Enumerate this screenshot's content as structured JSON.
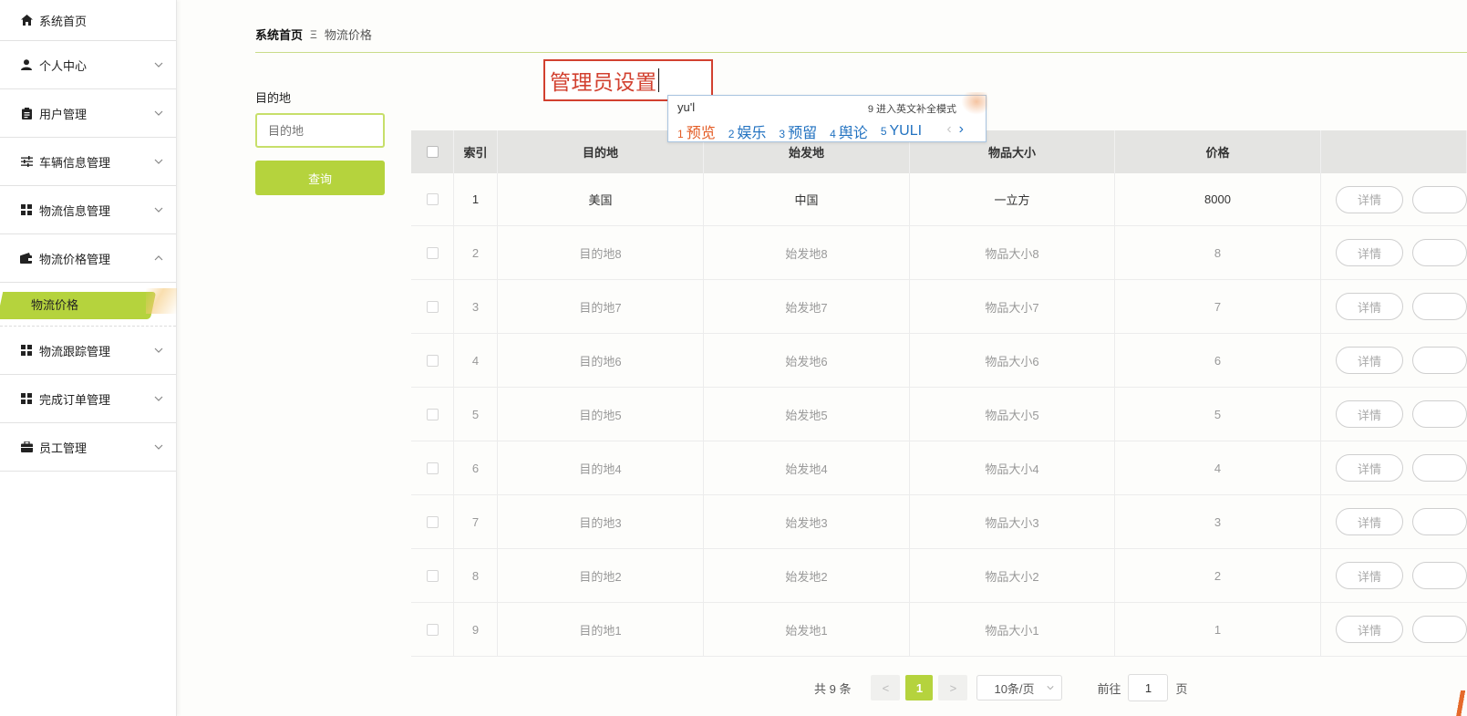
{
  "sidebar": {
    "items": [
      {
        "label": "系统首页",
        "icon": "home-icon"
      },
      {
        "label": "个人中心",
        "icon": "person-icon"
      },
      {
        "label": "用户管理",
        "icon": "clipboard-icon"
      },
      {
        "label": "车辆信息管理",
        "icon": "sliders-icon"
      },
      {
        "label": "物流信息管理",
        "icon": "grid-icon"
      },
      {
        "label": "物流价格管理",
        "icon": "wallet-icon"
      },
      {
        "label": "物流跟踪管理",
        "icon": "grid-icon"
      },
      {
        "label": "完成订单管理",
        "icon": "grid-icon"
      },
      {
        "label": "员工管理",
        "icon": "briefcase-icon"
      }
    ],
    "submenu_active": "物流价格"
  },
  "breadcrumb": {
    "home": "系统首页",
    "separator": "Ξ",
    "current": "物流价格"
  },
  "filter": {
    "label": "目的地",
    "placeholder": "目的地",
    "query_label": "查询"
  },
  "ime": {
    "typed": "管理员设置",
    "pinyin": "yu'l",
    "hint": "9 进入英文补全模式",
    "candidates": [
      {
        "num": "1",
        "text": "预览"
      },
      {
        "num": "2",
        "text": "娱乐"
      },
      {
        "num": "3",
        "text": "预留"
      },
      {
        "num": "4",
        "text": "舆论"
      },
      {
        "num": "5",
        "text": "YULI"
      }
    ],
    "prev": "‹",
    "next": "›"
  },
  "table": {
    "headers": {
      "index": "索引",
      "dest": "目的地",
      "origin": "始发地",
      "size": "物品大小",
      "price": "价格"
    },
    "rows": [
      {
        "index": "1",
        "dest": "美国",
        "origin": "中国",
        "size": "一立方",
        "price": "8000"
      },
      {
        "index": "2",
        "dest": "目的地8",
        "origin": "始发地8",
        "size": "物品大小8",
        "price": "8"
      },
      {
        "index": "3",
        "dest": "目的地7",
        "origin": "始发地7",
        "size": "物品大小7",
        "price": "7"
      },
      {
        "index": "4",
        "dest": "目的地6",
        "origin": "始发地6",
        "size": "物品大小6",
        "price": "6"
      },
      {
        "index": "5",
        "dest": "目的地5",
        "origin": "始发地5",
        "size": "物品大小5",
        "price": "5"
      },
      {
        "index": "6",
        "dest": "目的地4",
        "origin": "始发地4",
        "size": "物品大小4",
        "price": "4"
      },
      {
        "index": "7",
        "dest": "目的地3",
        "origin": "始发地3",
        "size": "物品大小3",
        "price": "3"
      },
      {
        "index": "8",
        "dest": "目的地2",
        "origin": "始发地2",
        "size": "物品大小2",
        "price": "2"
      },
      {
        "index": "9",
        "dest": "目的地1",
        "origin": "始发地1",
        "size": "物品大小1",
        "price": "1"
      }
    ],
    "detail_label": "详情"
  },
  "pagination": {
    "total": "共 9 条",
    "prev": "<",
    "current": "1",
    "next": ">",
    "page_size": "10条/页",
    "goto_label": "前往",
    "goto_value": "1",
    "page_unit": "页"
  },
  "colors": {
    "accent": "#b5d33d",
    "ime_red": "#d2402f",
    "ime_blue": "#2373c1"
  }
}
